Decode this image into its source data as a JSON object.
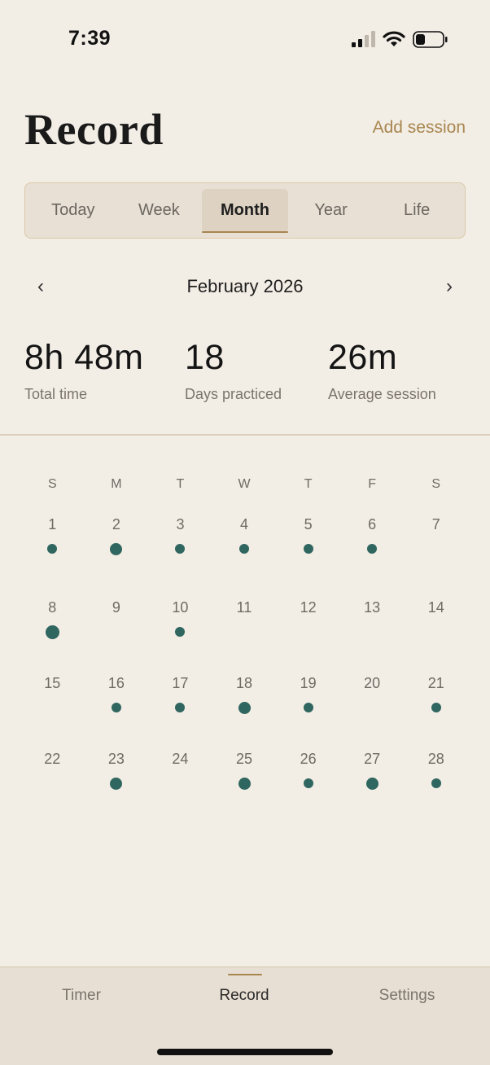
{
  "status_bar": {
    "time": "7:39",
    "signal_icon": "cellular-signal-icon",
    "wifi_icon": "wifi-icon",
    "battery_icon": "battery-icon"
  },
  "header": {
    "title": "Record",
    "add_session": "Add session"
  },
  "segments": {
    "items": [
      "Today",
      "Week",
      "Month",
      "Year",
      "Life"
    ],
    "active": "Month"
  },
  "month_nav": {
    "prev": "‹",
    "label": "February 2026",
    "next": "›"
  },
  "stats": {
    "total_time": {
      "value": "8h 48m",
      "label": "Total time"
    },
    "days_practiced": {
      "value": "18",
      "label": "Days practiced"
    },
    "average_session": {
      "value": "26m",
      "label": "Average session"
    }
  },
  "calendar": {
    "weekdays": [
      "S",
      "M",
      "T",
      "W",
      "T",
      "F",
      "S"
    ],
    "weeks": [
      [
        {
          "day": "1",
          "dot": "small"
        },
        {
          "day": "2",
          "dot": "medium"
        },
        {
          "day": "3",
          "dot": "small"
        },
        {
          "day": "4",
          "dot": "small"
        },
        {
          "day": "5",
          "dot": "small"
        },
        {
          "day": "6",
          "dot": "small"
        },
        {
          "day": "7",
          "dot": ""
        }
      ],
      [
        {
          "day": "8",
          "dot": "large"
        },
        {
          "day": "9",
          "dot": ""
        },
        {
          "day": "10",
          "dot": "small"
        },
        {
          "day": "11",
          "dot": ""
        },
        {
          "day": "12",
          "dot": ""
        },
        {
          "day": "13",
          "dot": ""
        },
        {
          "day": "14",
          "dot": ""
        }
      ],
      [
        {
          "day": "15",
          "dot": ""
        },
        {
          "day": "16",
          "dot": "small"
        },
        {
          "day": "17",
          "dot": "small"
        },
        {
          "day": "18",
          "dot": "medium"
        },
        {
          "day": "19",
          "dot": "small"
        },
        {
          "day": "20",
          "dot": ""
        },
        {
          "day": "21",
          "dot": "small"
        }
      ],
      [
        {
          "day": "22",
          "dot": ""
        },
        {
          "day": "23",
          "dot": "medium"
        },
        {
          "day": "24",
          "dot": ""
        },
        {
          "day": "25",
          "dot": "medium"
        },
        {
          "day": "26",
          "dot": "small"
        },
        {
          "day": "27",
          "dot": "medium"
        },
        {
          "day": "28",
          "dot": "small"
        }
      ]
    ]
  },
  "tab_bar": {
    "timer": "Timer",
    "record": "Record",
    "settings": "Settings",
    "active": "Record"
  },
  "colors": {
    "background": "#f2ede5",
    "accent": "#a8864f",
    "dot": "#2f665f",
    "tab_bar": "#e7dfd3"
  }
}
